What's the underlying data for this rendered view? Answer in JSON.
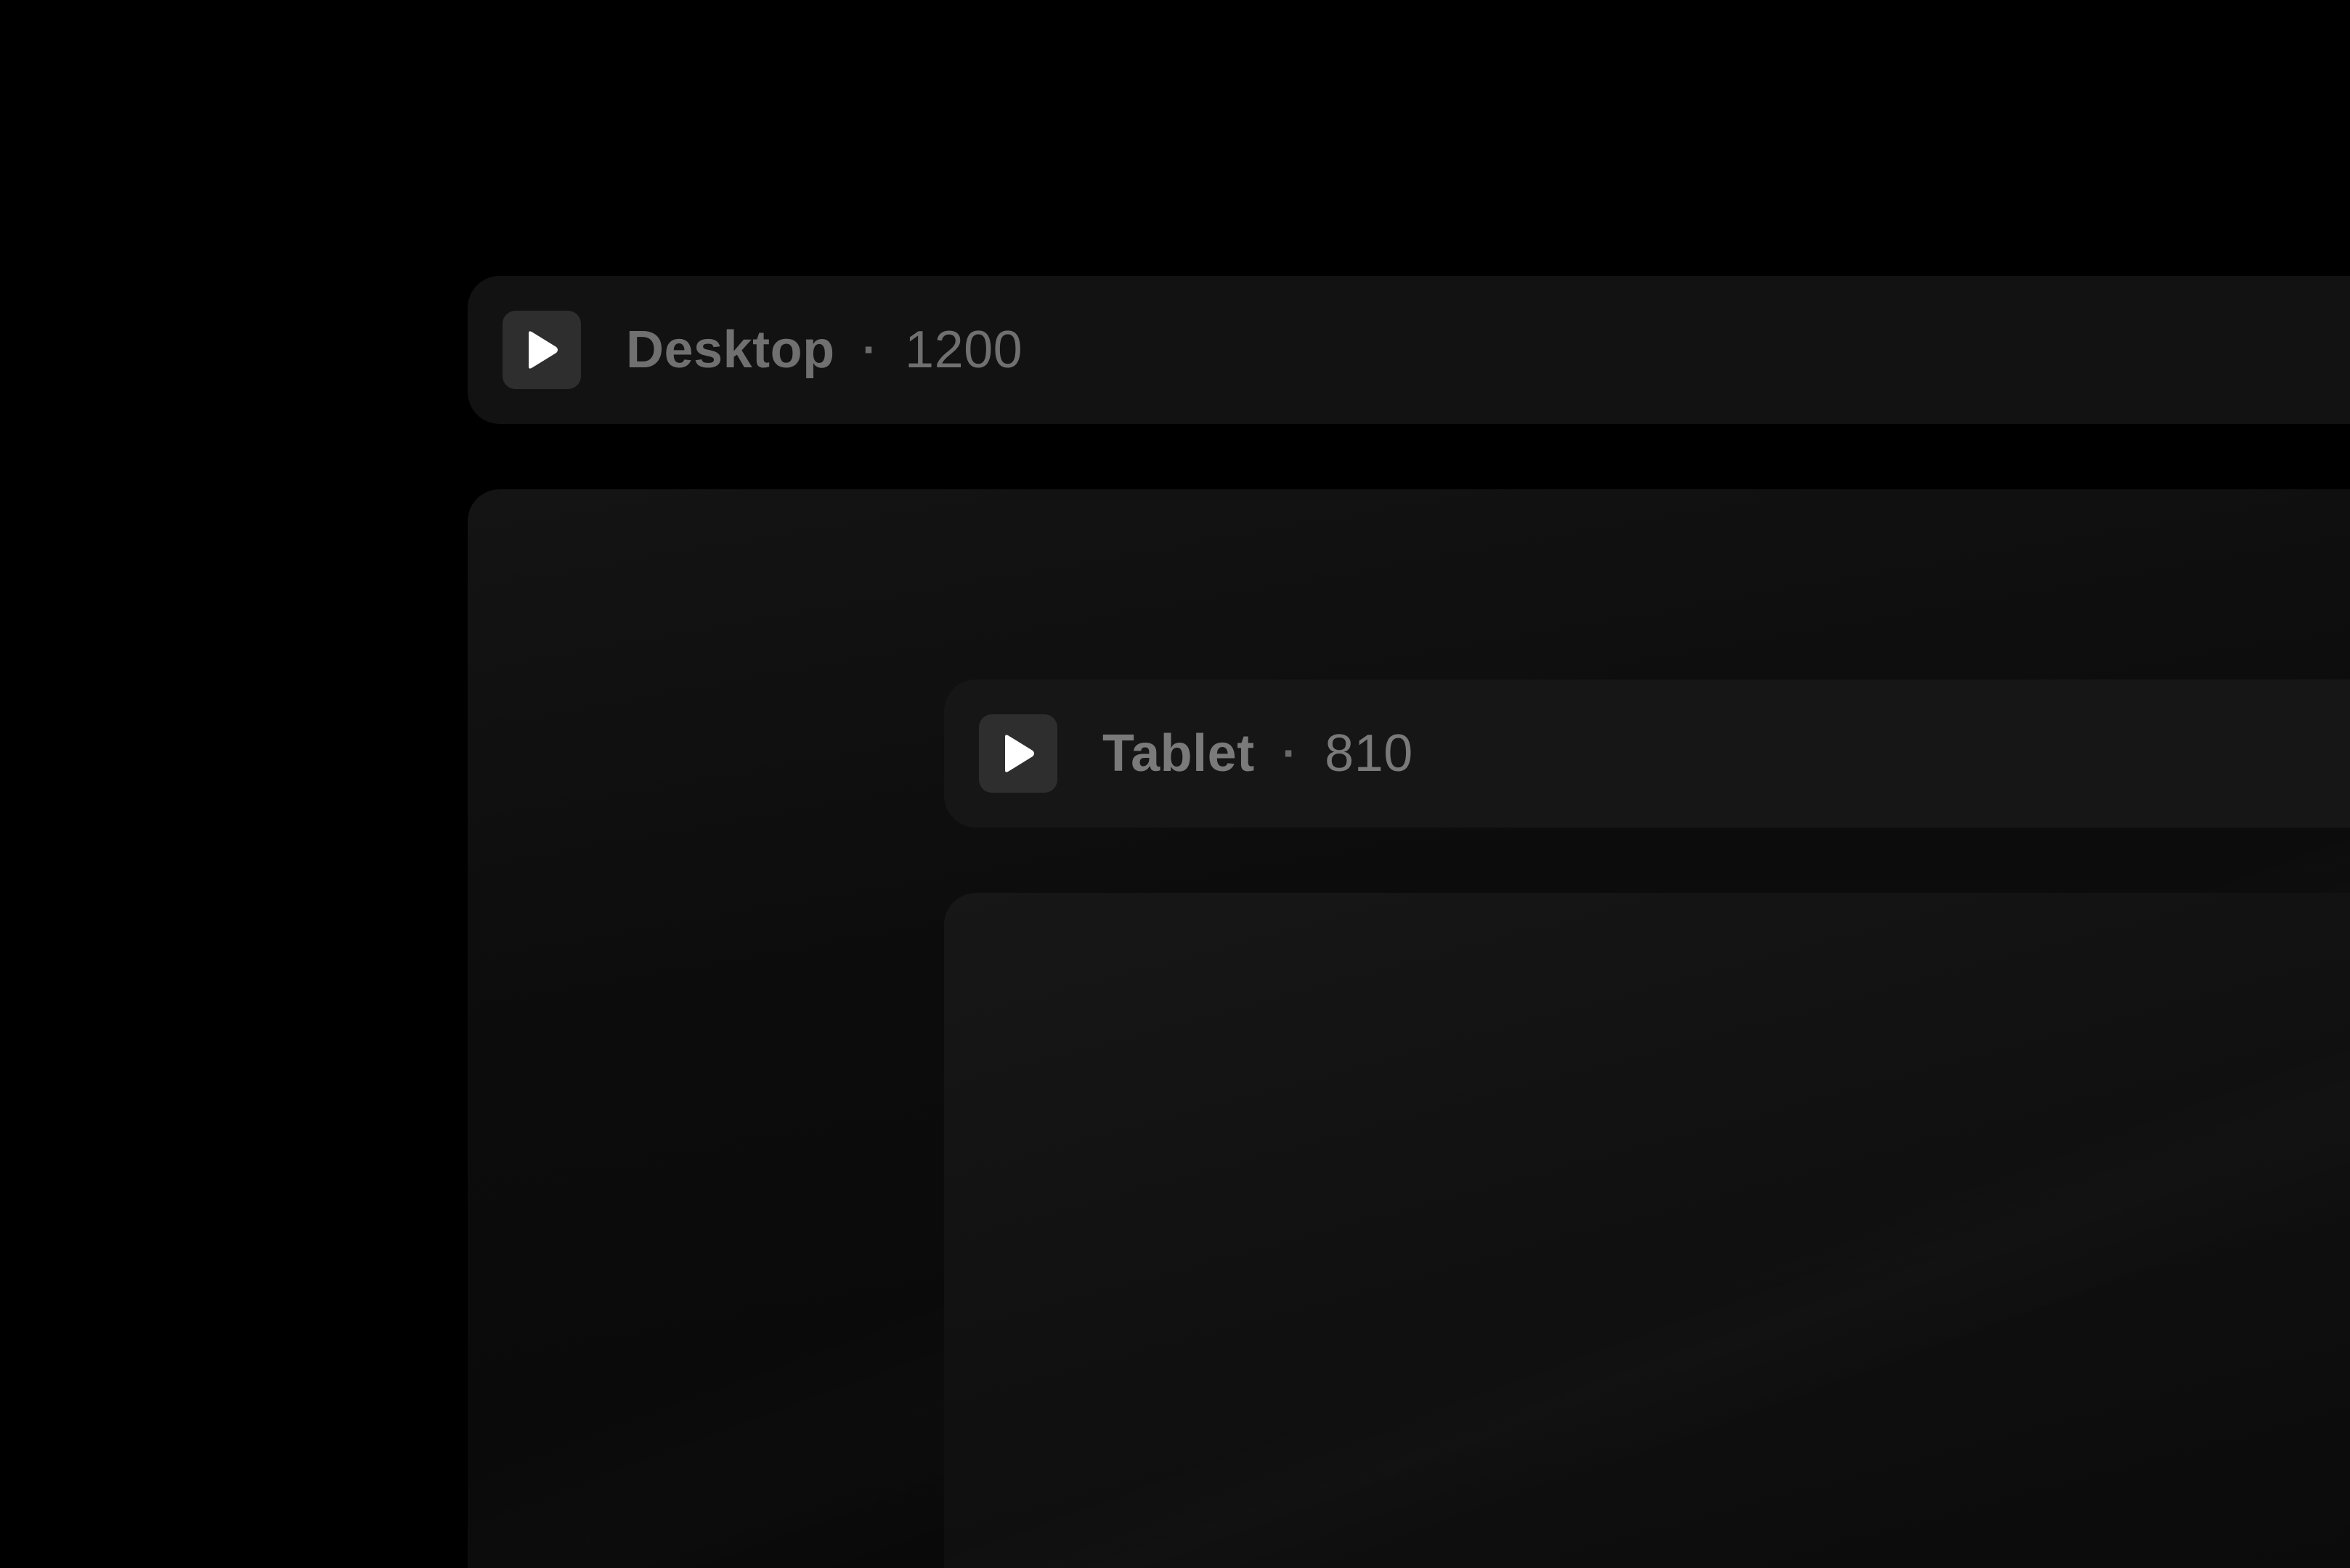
{
  "breakpoints": [
    {
      "name": "Desktop",
      "separator": "·",
      "width": "1200",
      "icon": "play-icon"
    },
    {
      "name": "Tablet",
      "separator": "·",
      "width": "810",
      "icon": "play-icon"
    }
  ],
  "colors": {
    "background": "#000000",
    "header_bg": "#121212",
    "icon_bg": "#2e2e2e",
    "icon_fg": "#ffffff",
    "label": "#707070"
  }
}
